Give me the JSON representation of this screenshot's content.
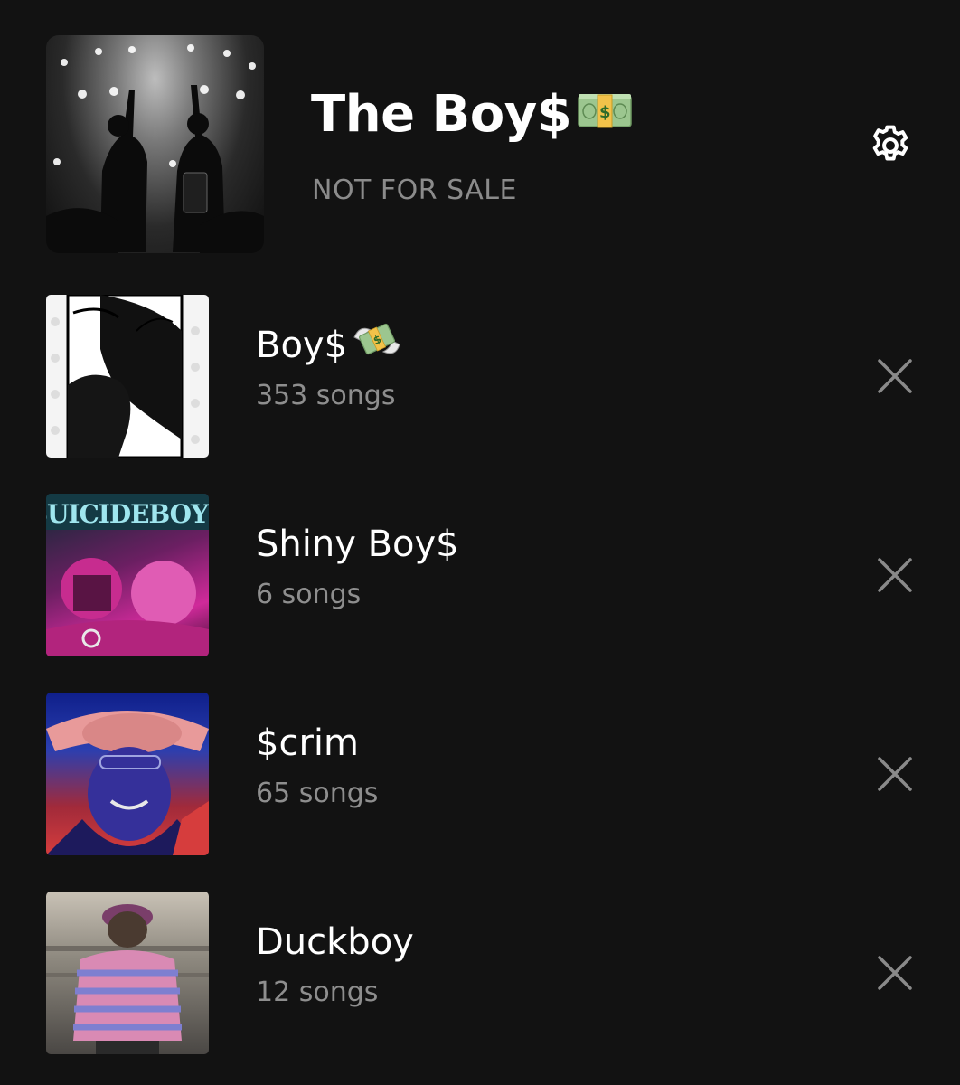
{
  "header": {
    "title": "The Boy$",
    "title_emoji": "money-bundle",
    "subtitle": "NOT FOR SALE",
    "settings_icon": "gear-icon"
  },
  "playlists": [
    {
      "title": "Boy$",
      "title_emoji": "money-with-wings",
      "count": "353 songs",
      "thumb": "sketch-art"
    },
    {
      "title": "Shiny Boy$",
      "count": "6 songs",
      "thumb": "suicideboys-cover"
    },
    {
      "title": "$crim",
      "count": "65 songs",
      "thumb": "cowboy-hat-photo"
    },
    {
      "title": "Duckboy",
      "count": "12 songs",
      "thumb": "striped-shirt-photo"
    }
  ],
  "colors": {
    "background": "#121212",
    "primary_text": "#ffffff",
    "secondary_text": "#8e8e8e",
    "icon": "#8a8a8a"
  }
}
